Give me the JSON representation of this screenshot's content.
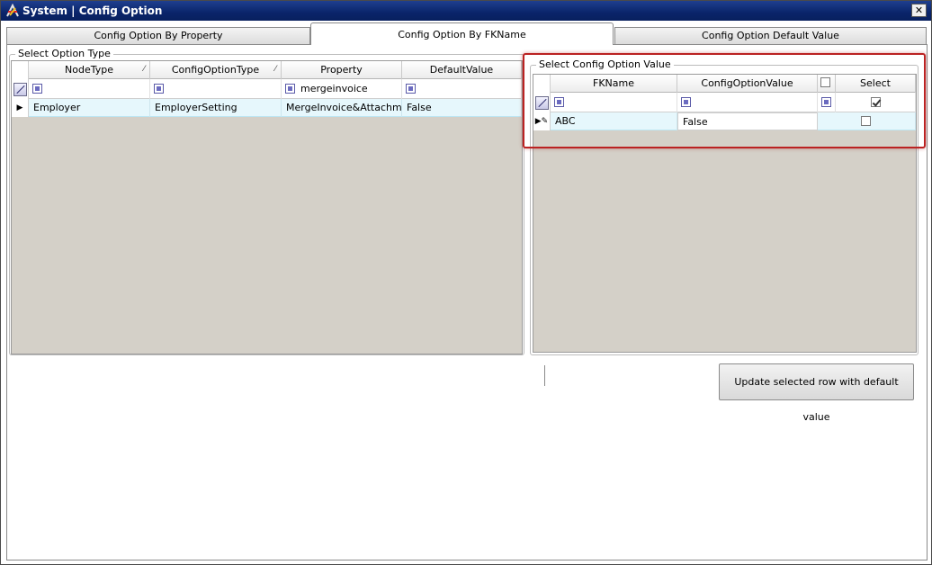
{
  "window": {
    "title": "System | Config Option",
    "close_label": "✕"
  },
  "tabs": [
    {
      "label": "Config Option By Property",
      "active": false
    },
    {
      "label": "Config Option By FKName",
      "active": true
    },
    {
      "label": "Config Option Default Value",
      "active": false
    }
  ],
  "left_panel": {
    "group_title": "Select Option Type",
    "columns": [
      "NodeType",
      "ConfigOptionType",
      "Property",
      "DefaultValue"
    ],
    "sort_indicator": "⁄",
    "filters": [
      "",
      "",
      "mergeinvoice",
      ""
    ],
    "rows": [
      {
        "cells": [
          "Employer",
          "EmployerSetting",
          "MergeInvoice&Attachm",
          "False"
        ],
        "indicator": "▶"
      }
    ]
  },
  "right_panel": {
    "group_title": "Select Config Option Value",
    "columns": [
      "FKName",
      "ConfigOptionValue",
      "",
      "Select"
    ],
    "filters": [
      "",
      "",
      "",
      ""
    ],
    "filter_select_checked": true,
    "header_select_checked": false,
    "rows": [
      {
        "cells": [
          "ABC",
          "False"
        ],
        "selected": false,
        "indicator": "▶✎"
      }
    ]
  },
  "actions": {
    "update_label": "Update selected row with default value"
  },
  "colors": {
    "titlebar": "#0a246a",
    "grid_background": "#d4d0c8",
    "row_highlight": "#e6f7fc",
    "annotation_outline": "#b22222"
  }
}
